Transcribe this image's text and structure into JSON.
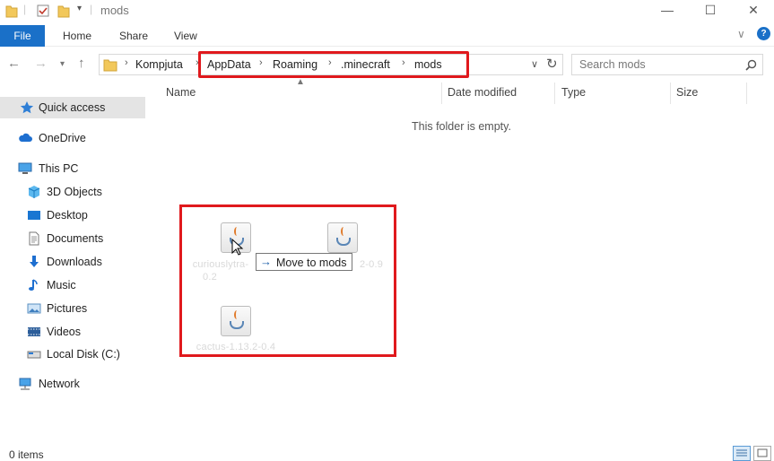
{
  "window": {
    "title": "mods",
    "controls": {
      "minimize": "—",
      "maximize": "☐",
      "close": "✕"
    }
  },
  "ribbon": {
    "tabs": [
      {
        "label": "File"
      },
      {
        "label": "Home"
      },
      {
        "label": "Share"
      },
      {
        "label": "View"
      }
    ]
  },
  "address": {
    "breadcrumbs": [
      "Kompjuta",
      "AppData",
      "Roaming",
      ".minecraft",
      "mods"
    ],
    "search_placeholder": "Search mods"
  },
  "nav": {
    "items": [
      {
        "label": "Quick access",
        "icon": "star-icon",
        "selected": true
      },
      {
        "label": "OneDrive",
        "icon": "cloud-icon"
      },
      {
        "label": "This PC",
        "icon": "computer-icon"
      },
      {
        "label": "3D Objects",
        "icon": "cube-icon"
      },
      {
        "label": "Desktop",
        "icon": "desktop-icon"
      },
      {
        "label": "Documents",
        "icon": "document-icon"
      },
      {
        "label": "Downloads",
        "icon": "download-icon"
      },
      {
        "label": "Music",
        "icon": "music-icon"
      },
      {
        "label": "Pictures",
        "icon": "picture-icon"
      },
      {
        "label": "Videos",
        "icon": "video-icon"
      },
      {
        "label": "Local Disk (C:)",
        "icon": "disk-icon"
      },
      {
        "label": "Network",
        "icon": "network-icon"
      }
    ]
  },
  "content": {
    "columns": [
      "Name",
      "Date modified",
      "Type",
      "Size"
    ],
    "empty_message": "This folder is empty.",
    "dragged_files": [
      {
        "label_line1": "curiouslytra-",
        "label_line2": "0.2"
      },
      {
        "label_line1": "2-0.9",
        "label_line2": ""
      },
      {
        "label_line1": "cactus-1.13.2-0.4",
        "label_line2": ""
      }
    ],
    "drag_tooltip": "Move to mods"
  },
  "status": {
    "item_count": "0 items"
  },
  "colors": {
    "accent": "#1a70c8",
    "highlight_box": "#e0191d"
  }
}
